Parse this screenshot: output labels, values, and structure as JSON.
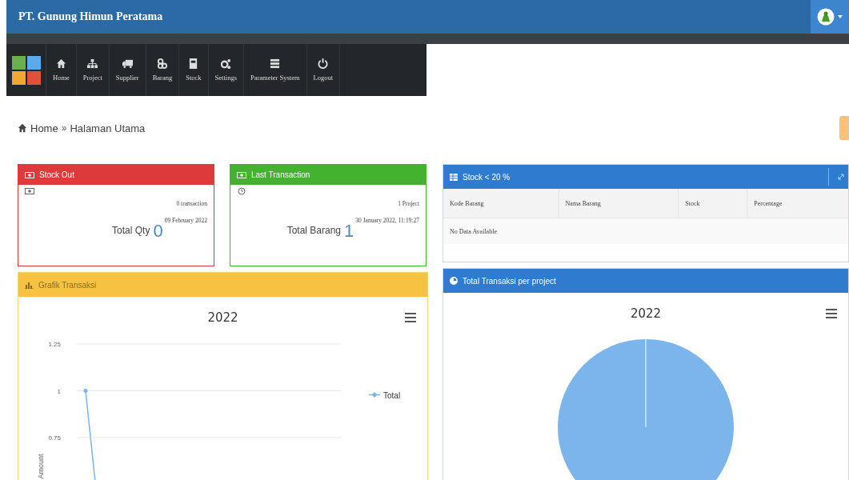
{
  "header": {
    "title": "PT. Gunung Himun Peratama"
  },
  "nav": {
    "items": [
      {
        "label": "Home"
      },
      {
        "label": "Project"
      },
      {
        "label": "Supplier"
      },
      {
        "label": "Barang"
      },
      {
        "label": "Stock"
      },
      {
        "label": "Settings"
      },
      {
        "label": "Parameter System"
      },
      {
        "label": "Logout"
      }
    ]
  },
  "breadcrumb": [
    {
      "label": "Home",
      "kind": "link"
    },
    {
      "label": "»",
      "kind": "sep"
    },
    {
      "label": "Halaman Utama",
      "kind": "text"
    }
  ],
  "cards": [
    {
      "title": "Stock Out",
      "color": "#dd3b3b",
      "count": "0 transaction",
      "label": "Total Qty",
      "value": "0",
      "date": "09 February 2022"
    },
    {
      "title": "Last Transaction",
      "color": "#42b22f",
      "count": "1 Project",
      "label": "Total Barang",
      "value": "1",
      "date": "30 January 2022, 11:19:27"
    }
  ],
  "stock_table": {
    "title": "Stock < 20 %",
    "columns": [
      "Kode Barang",
      "Nama Barang",
      "Stock",
      "Percentage"
    ],
    "empty": "No Data Available"
  },
  "line_panel": {
    "title": "Grafik Transaksi",
    "chart_title": "2022",
    "y_axis_title": "Amount",
    "y_tick_labels": [
      "1.25",
      "1",
      "0.75"
    ],
    "legend": [
      {
        "name": "Total",
        "color": "#7cb5ec"
      }
    ]
  },
  "pie_panel": {
    "title": "Total Transaksi per project",
    "chart_title": "2022"
  }
}
